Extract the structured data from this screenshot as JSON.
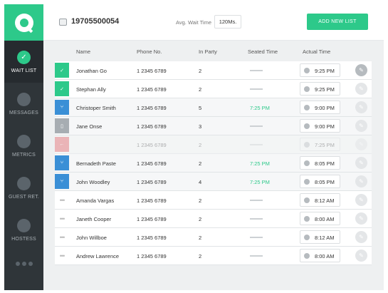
{
  "colors": {
    "accent": "#2dc98a",
    "sidebar": "#2f3539",
    "blue": "#3a8fd6",
    "gray": "#a7adb2",
    "red": "#e5484d"
  },
  "sidebar": {
    "items": [
      {
        "label": "WAIT LIST",
        "icon": "check-icon",
        "active": true
      },
      {
        "label": "MESSAGES",
        "icon": "chat-icon",
        "active": false
      },
      {
        "label": "METRICS",
        "icon": "chart-icon",
        "active": false
      },
      {
        "label": "GUEST RET.",
        "icon": "share-icon",
        "active": false
      },
      {
        "label": "HOSTESS",
        "icon": "person-icon",
        "active": false
      }
    ]
  },
  "header": {
    "id_number": "19705500054",
    "wait_label": "Avg. Wait Time",
    "wait_value": "120Ms.",
    "add_button": "ADD NEW LIST"
  },
  "table": {
    "columns": [
      "Name",
      "Phone No.",
      "In Party",
      "Seated Time",
      "Actual Time"
    ],
    "rows": [
      {
        "status": "checked",
        "name": "Jonathan Go",
        "phone": "1 2345 6789",
        "party": "2",
        "seated": "",
        "actual": "9:25 PM"
      },
      {
        "status": "checked",
        "name": "Stephan Ally",
        "phone": "1 2345 6789",
        "party": "2",
        "seated": "",
        "actual": "9:25 PM"
      },
      {
        "status": "seated",
        "name": "Christoper Smith",
        "phone": "1 2345 6789",
        "party": "5",
        "seated": "7:25 PM",
        "actual": "9:00 PM"
      },
      {
        "status": "phone",
        "name": "Jane Onse",
        "phone": "1 2345 6789",
        "party": "3",
        "seated": "",
        "actual": "9:00 PM"
      },
      {
        "status": "removed",
        "name": "",
        "phone": "1 2345 6789",
        "party": "2",
        "seated": "",
        "actual": "7:25 PM"
      },
      {
        "status": "seated",
        "name": "Bernadeth Paste",
        "phone": "1 2345 6789",
        "party": "2",
        "seated": "7:25 PM",
        "actual": "8:05 PM"
      },
      {
        "status": "seated",
        "name": "John Woodley",
        "phone": "1 2345 6789",
        "party": "4",
        "seated": "7:25 PM",
        "actual": "8:05 PM"
      },
      {
        "status": "waiting",
        "name": "Amanda Vargas",
        "phone": "1 2345 6789",
        "party": "2",
        "seated": "",
        "actual": "8:12 AM"
      },
      {
        "status": "waiting",
        "name": "Janeth Cooper",
        "phone": "1 2345 6789",
        "party": "2",
        "seated": "",
        "actual": "8:00 AM"
      },
      {
        "status": "waiting",
        "name": "John Willboe",
        "phone": "1 2345 6789",
        "party": "2",
        "seated": "",
        "actual": "8:12 AM"
      },
      {
        "status": "waiting",
        "name": "Andrew Lawrence",
        "phone": "1 2345 6789",
        "party": "2",
        "seated": "",
        "actual": "8:00 AM"
      }
    ]
  }
}
